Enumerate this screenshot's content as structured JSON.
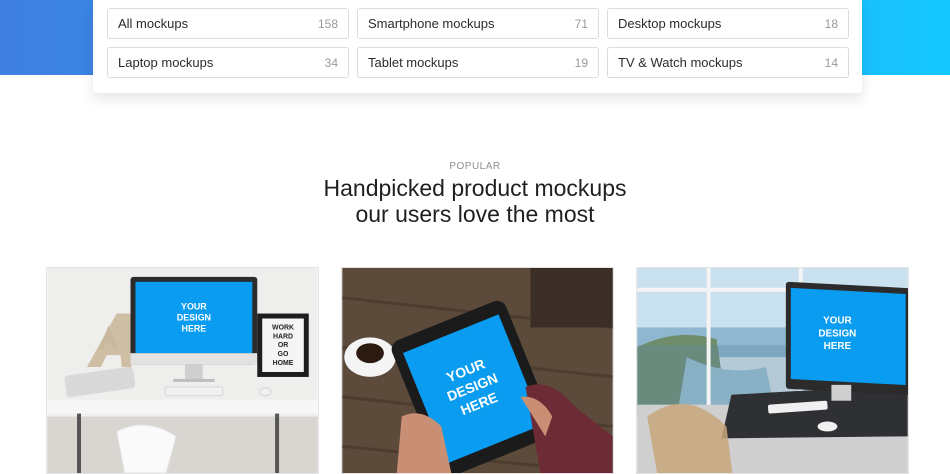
{
  "filters": [
    {
      "label": "All mockups",
      "count": "158"
    },
    {
      "label": "Smartphone mockups",
      "count": "71"
    },
    {
      "label": "Desktop mockups",
      "count": "18"
    },
    {
      "label": "Laptop mockups",
      "count": "34"
    },
    {
      "label": "Tablet mockups",
      "count": "19"
    },
    {
      "label": "TV & Watch mockups",
      "count": "14"
    }
  ],
  "section": {
    "eyebrow": "POPULAR",
    "title_line1": "Handpicked product mockups",
    "title_line2": "our users love the most"
  },
  "cards": [
    {
      "screen_text": [
        "YOUR",
        "DESIGN",
        "HERE"
      ],
      "poster_text": [
        "WORK",
        "HARD",
        "OR",
        "GO",
        "HOME"
      ]
    },
    {
      "screen_text": [
        "YOUR",
        "DESIGN",
        "HERE"
      ]
    },
    {
      "screen_text": [
        "YOUR",
        "DESIGN",
        "HERE"
      ]
    }
  ],
  "colors": {
    "screen_blue": "#0a9cf0",
    "gradient_start": "#3f7fe0",
    "gradient_end": "#15c8ff"
  }
}
